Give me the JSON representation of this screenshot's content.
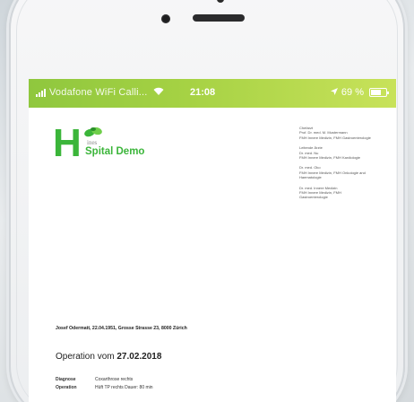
{
  "status_bar": {
    "carrier": "Vodafone WiFi Calli...",
    "time": "21:08",
    "battery": "69 %",
    "battery_level": 0.69,
    "icons": [
      "signal-icon",
      "wifi-icon",
      "location-icon",
      "battery-icon"
    ]
  },
  "logo": {
    "letter": "H",
    "ines": "ines",
    "name": "Spital Demo",
    "brand_color": "#3bb53a"
  },
  "staff": [
    [
      "Chefarzt",
      "Prof. Dr. med. M. Mustermann",
      "FMH Innere Medizin, FMH Gastroenterologie"
    ],
    [
      "Leitende Ärzte",
      "Dr. med. Nu",
      "FMH Innere Medizin, FMH Kardiologie"
    ],
    [
      "Dr. med. Oko",
      "FMH Innere Medizin, FMH Onkologie and",
      "Haematologie"
    ],
    [
      "Dr. med. Innere Medizin",
      "FMH Innere Medizin, FMH",
      "Gastroenterologie"
    ]
  ],
  "patient_line": "Josef Odermatt, 22.04.1951, Grosse Strasse 23, 8000 Zürich",
  "operation": {
    "title_prefix": "Operation vom",
    "date": "27.02.2018",
    "diagnose_label": "Diagnose",
    "diagnose_value": "Coxarthrose rechts",
    "operation_label": "Operation",
    "operation_value": "Hüft TP rechts  Dauer: 80 min"
  }
}
